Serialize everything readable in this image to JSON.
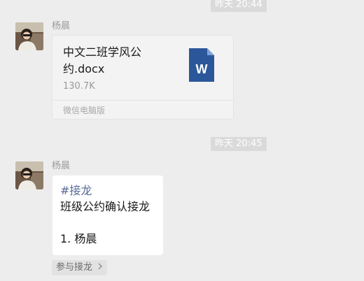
{
  "messages": [
    {
      "timestamp": "昨天 20:44",
      "sender": "杨晨",
      "file": {
        "name": "中文二班学风公约.docx",
        "size": "130.7K",
        "icon": "word-document-icon",
        "icon_letter": "W",
        "source": "微信电脑版"
      }
    },
    {
      "timestamp": "昨天 20:45",
      "sender": "杨晨",
      "jielong": {
        "tag": "#接龙",
        "title": "班级公约确认接龙",
        "entry": "1. 杨晨",
        "join_label": "参与接龙"
      }
    }
  ],
  "colors": {
    "background": "#ededed",
    "link_blue": "#576b95",
    "word_blue": "#2b579a"
  }
}
